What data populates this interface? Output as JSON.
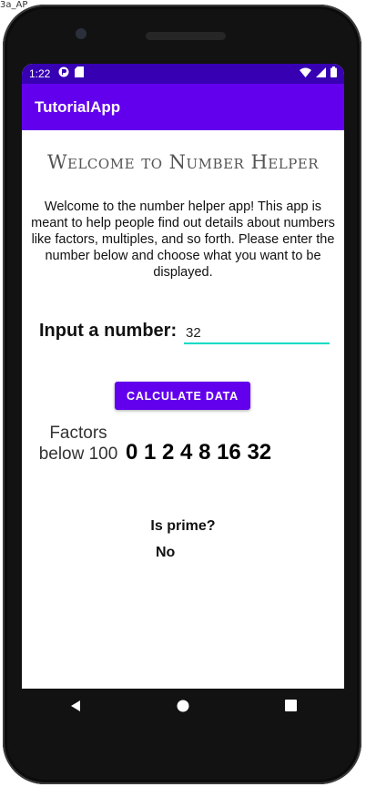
{
  "window": {
    "label": "3a_AP"
  },
  "statusbar": {
    "time": "1:22"
  },
  "appbar": {
    "title": "TutorialApp"
  },
  "content": {
    "welcome_title": "Welcome to Number Helper",
    "intro": "Welcome to the number helper app! This app is meant to help people find out details about numbers like factors, multiples, and so forth. Please enter the number below and choose what you want to be displayed.",
    "input_label": "Input a number:",
    "input_value": "32",
    "button_label": "CALCULATE DATA",
    "factors_label": "Factors below 100",
    "factors_value": "0 1 2 4 8 16 32",
    "prime_label": "Is prime?",
    "prime_value": "No"
  },
  "icons": {
    "status_left": [
      "app-notification-icon",
      "sd-card-icon"
    ],
    "status_right": [
      "wifi-icon",
      "signal-icon",
      "battery-icon"
    ],
    "nav": [
      "back-icon",
      "home-icon",
      "recents-icon"
    ]
  },
  "colors": {
    "statusbar": "#3700b3",
    "appbar": "#6200ee",
    "button": "#6200ee",
    "input_underline": "#03dac5"
  }
}
